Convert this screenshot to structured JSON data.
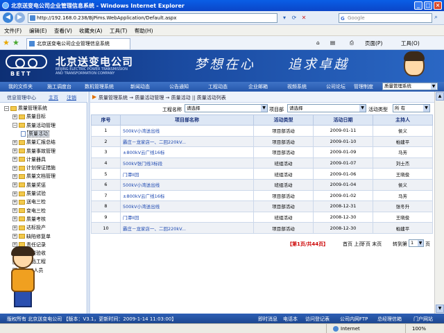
{
  "window": {
    "title": "北京送变电公司企业管理信息系统 - Windows Internet Explorer",
    "controls": [
      "_",
      "□",
      "×"
    ]
  },
  "address": {
    "url": "http://192.168.0.238/BjPims.WebApplication/Default.aspx",
    "search_placeholder": "Google"
  },
  "menu": [
    "文件(F)",
    "编辑(E)",
    "查看(V)",
    "收藏夹(A)",
    "工具(T)",
    "帮助(H)"
  ],
  "browser_tab": {
    "title": "北京送变电公司企业管理信息系统",
    "commands": [
      "页面(P)",
      "工具(O)"
    ]
  },
  "banner": {
    "logo_text": "BETT",
    "company_cn": "北京送变电公司",
    "company_en": "BEIJING ELECTRIC POWER TRANSMISSION AND TRANSFORMATION COMPANY",
    "slogan_left": "梦想在心",
    "slogan_right": "追求卓越"
  },
  "site_nav": {
    "items": [
      "我的文件夹",
      "施工调度台",
      "数机管理系统",
      "新闻动态",
      "公告通知",
      "工程动态",
      "企业邮箱",
      "视频系统",
      "公司论坛",
      "管理制度"
    ],
    "system_select": "质量管理系统"
  },
  "left_panel": {
    "heading": "信息管理中心",
    "links": [
      "主页",
      "注销"
    ],
    "tree": [
      {
        "label": "质量管理系统",
        "level": 0,
        "type": "root"
      },
      {
        "label": "质量目标",
        "level": 1,
        "type": "folder"
      },
      {
        "label": "质量活动管理",
        "level": 1,
        "type": "folder"
      },
      {
        "label": "质量活动",
        "level": 2,
        "type": "doc",
        "selected": true
      },
      {
        "label": "质量汇报总结",
        "level": 1,
        "type": "folder"
      },
      {
        "label": "质量事故管理",
        "level": 1,
        "type": "folder"
      },
      {
        "label": "计量器具",
        "level": 1,
        "type": "folder"
      },
      {
        "label": "计划保证措施",
        "level": 1,
        "type": "folder"
      },
      {
        "label": "质量文档管理",
        "level": 1,
        "type": "folder"
      },
      {
        "label": "质量奖惩",
        "level": 1,
        "type": "folder"
      },
      {
        "label": "质量试验",
        "level": 1,
        "type": "folder"
      },
      {
        "label": "送电三检",
        "level": 1,
        "type": "folder"
      },
      {
        "label": "变电三检",
        "level": 1,
        "type": "folder"
      },
      {
        "label": "质量考核",
        "level": 1,
        "type": "folder"
      },
      {
        "label": "达标投产",
        "level": 1,
        "type": "folder"
      },
      {
        "label": "缺陷修复单",
        "level": 1,
        "type": "folder"
      },
      {
        "label": "责任记录",
        "level": 1,
        "type": "folder"
      },
      {
        "label": "质量验收",
        "level": 1,
        "type": "folder"
      },
      {
        "label": "精品工程",
        "level": 1,
        "type": "folder"
      },
      {
        "label": "QC人员",
        "level": 1,
        "type": "folder"
      }
    ]
  },
  "breadcrumb": "质量管理系统 → 质量活动管理 → 质量活动 || 质量活动列表",
  "filters": {
    "project_label": "工程名称",
    "project_value": "请选择",
    "dept_label": "项目部",
    "dept_value": "请选择",
    "type_label": "活动类型",
    "type_value": "所 有"
  },
  "table": {
    "headers": [
      "序号",
      "项目部名称",
      "活动类型",
      "活动日期",
      "主持人"
    ],
    "rows": [
      [
        "1",
        "500kV小湾送出线",
        "项目部活动",
        "2009-01-11",
        "侯义"
      ],
      [
        "2",
        "霸庄－龙家店一、二回220kV...",
        "项目部活动",
        "2009-01-10",
        "柏建平"
      ],
      [
        "3",
        "±800kV云广线16标",
        "项目部活动",
        "2009-01-09",
        "马芳"
      ],
      [
        "4",
        "500kV张门线3标段",
        "班组活动",
        "2009-01-07",
        "刘士杰"
      ],
      [
        "5",
        "门潭II回",
        "班组活动",
        "2009-01-06",
        "王晓俊"
      ],
      [
        "6",
        "500kV小湾送出线",
        "班组活动",
        "2009-01-04",
        "侯义"
      ],
      [
        "7",
        "±800kV云广线16标",
        "项目部活动",
        "2009-01-02",
        "马芳"
      ],
      [
        "8",
        "500kV小湾送出线",
        "项目部活动",
        "2008-12-31",
        "张冬升"
      ],
      [
        "9",
        "门潭II回",
        "班组活动",
        "2008-12-30",
        "王晓俊"
      ],
      [
        "10",
        "霸庄－龙家店一、二回220kV...",
        "项目部活动",
        "2008-12-30",
        "柏建平"
      ]
    ]
  },
  "pager": {
    "current": "【第1页/共44页】",
    "first_prev": "首页 上页",
    "next_last": "下页 末页",
    "goto_label": "转到第",
    "goto_value": "1",
    "goto_suffix": "页"
  },
  "footer": {
    "copyright": "版权所有 北京送变电公司 【版本：V3.1，更新时间：2009-1-14 11:03:00】",
    "links": [
      "即时消息",
      "电话本",
      "访问登记表",
      "公司内网FTP",
      "总经理信箱",
      "门户网站"
    ]
  },
  "status": {
    "zone": "Internet",
    "zoom": "100%"
  },
  "colors": {
    "banner_dark": "#0d2f74",
    "nav_blue": "#2557ac",
    "header_text": "#18317a",
    "pager_red": "#c00000"
  }
}
